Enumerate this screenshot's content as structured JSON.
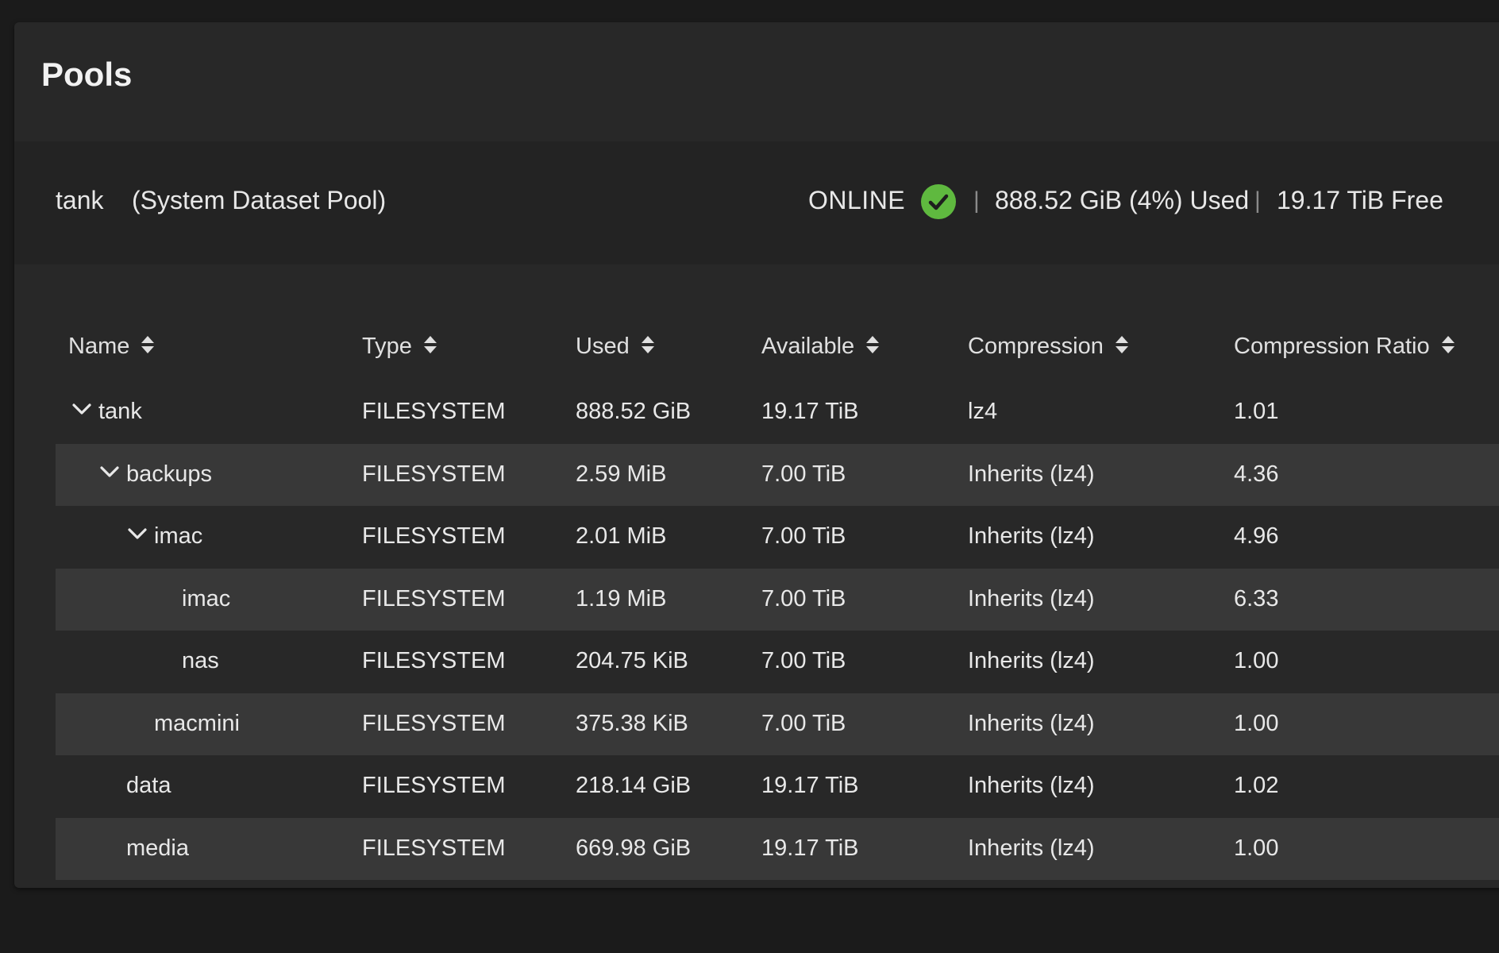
{
  "title": "Pools",
  "pool": {
    "name": "tank",
    "label": "(System Dataset Pool)",
    "status": "ONLINE",
    "status_icon": "check-circle-icon",
    "separator": "|",
    "used": "888.52 GiB (4%) Used",
    "free": "19.17 TiB Free",
    "status_color": "#5fb93f"
  },
  "table": {
    "columns": [
      "Name",
      "Type",
      "Used",
      "Available",
      "Compression",
      "Compression Ratio"
    ],
    "rows": [
      {
        "name": "tank",
        "type": "FILESYSTEM",
        "used": "888.52 GiB",
        "available": "19.17 TiB",
        "compression": "lz4",
        "ratio": "1.01",
        "level": 0,
        "expanded": true
      },
      {
        "name": "backups",
        "type": "FILESYSTEM",
        "used": "2.59 MiB",
        "available": "7.00 TiB",
        "compression": "Inherits (lz4)",
        "ratio": "4.36",
        "level": 1,
        "expanded": true
      },
      {
        "name": "imac",
        "type": "FILESYSTEM",
        "used": "2.01 MiB",
        "available": "7.00 TiB",
        "compression": "Inherits (lz4)",
        "ratio": "4.96",
        "level": 2,
        "expanded": true
      },
      {
        "name": "imac",
        "type": "FILESYSTEM",
        "used": "1.19 MiB",
        "available": "7.00 TiB",
        "compression": "Inherits (lz4)",
        "ratio": "6.33",
        "level": 3,
        "expanded": false
      },
      {
        "name": "nas",
        "type": "FILESYSTEM",
        "used": "204.75 KiB",
        "available": "7.00 TiB",
        "compression": "Inherits (lz4)",
        "ratio": "1.00",
        "level": 3,
        "expanded": false
      },
      {
        "name": "macmini",
        "type": "FILESYSTEM",
        "used": "375.38 KiB",
        "available": "7.00 TiB",
        "compression": "Inherits (lz4)",
        "ratio": "1.00",
        "level": 2,
        "expanded": false
      },
      {
        "name": "data",
        "type": "FILESYSTEM",
        "used": "218.14 GiB",
        "available": "19.17 TiB",
        "compression": "Inherits (lz4)",
        "ratio": "1.02",
        "level": 1,
        "expanded": false
      },
      {
        "name": "media",
        "type": "FILESYSTEM",
        "used": "669.98 GiB",
        "available": "19.17 TiB",
        "compression": "Inherits (lz4)",
        "ratio": "1.00",
        "level": 1,
        "expanded": false
      }
    ]
  }
}
